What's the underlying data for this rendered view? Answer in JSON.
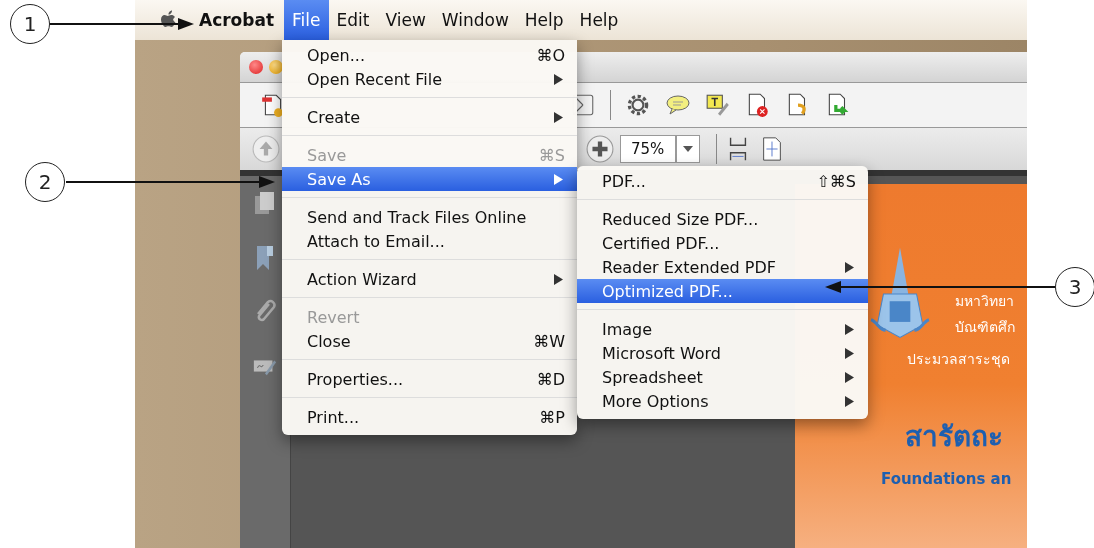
{
  "menu_bar": {
    "app": "Acrobat",
    "items": [
      {
        "label": "File",
        "selected": true
      },
      {
        "label": "Edit",
        "selected": false
      },
      {
        "label": "View",
        "selected": false
      },
      {
        "label": "Window",
        "selected": false
      },
      {
        "label": "Help",
        "selected": false
      },
      {
        "label": "Help",
        "selected": false
      }
    ]
  },
  "file_menu": {
    "groups": [
      {
        "items": [
          {
            "label": "Open...",
            "shortcut": "⌘O",
            "submenu": false,
            "disabled": false,
            "selected": false
          },
          {
            "label": "Open Recent File",
            "submenu": true,
            "disabled": false,
            "selected": false
          }
        ]
      },
      {
        "items": [
          {
            "label": "Create",
            "submenu": true,
            "disabled": false,
            "selected": false
          }
        ]
      },
      {
        "items": [
          {
            "label": "Save",
            "shortcut": "⌘S",
            "submenu": false,
            "disabled": true,
            "selected": false
          },
          {
            "label": "Save As",
            "submenu": true,
            "disabled": false,
            "selected": true
          }
        ]
      },
      {
        "items": [
          {
            "label": "Send and Track Files Online",
            "submenu": false,
            "disabled": false,
            "selected": false
          },
          {
            "label": "Attach to Email...",
            "submenu": false,
            "disabled": false,
            "selected": false
          }
        ]
      },
      {
        "items": [
          {
            "label": "Action Wizard",
            "submenu": true,
            "disabled": false,
            "selected": false
          }
        ]
      },
      {
        "items": [
          {
            "label": "Revert",
            "submenu": false,
            "disabled": true,
            "selected": false
          },
          {
            "label": "Close",
            "shortcut": "⌘W",
            "submenu": false,
            "disabled": false,
            "selected": false
          }
        ]
      },
      {
        "items": [
          {
            "label": "Properties...",
            "shortcut": "⌘D",
            "submenu": false,
            "disabled": false,
            "selected": false
          }
        ]
      },
      {
        "items": [
          {
            "label": "Print...",
            "shortcut": "⌘P",
            "submenu": false,
            "disabled": false,
            "selected": false
          }
        ]
      }
    ]
  },
  "save_as_menu": {
    "groups": [
      {
        "items": [
          {
            "label": "PDF...",
            "shortcut": "⇧⌘S",
            "submenu": false,
            "disabled": false,
            "selected": false
          }
        ]
      },
      {
        "items": [
          {
            "label": "Reduced Size PDF...",
            "submenu": false,
            "disabled": false,
            "selected": false
          },
          {
            "label": "Certified PDF...",
            "submenu": false,
            "disabled": false,
            "selected": false
          },
          {
            "label": "Reader Extended PDF",
            "submenu": true,
            "disabled": false,
            "selected": false
          },
          {
            "label": "Optimized PDF...",
            "submenu": false,
            "disabled": false,
            "selected": true
          }
        ]
      },
      {
        "items": [
          {
            "label": "Image",
            "submenu": true,
            "disabled": false,
            "selected": false
          },
          {
            "label": "Microsoft Word",
            "submenu": true,
            "disabled": false,
            "selected": false
          },
          {
            "label": "Spreadsheet",
            "submenu": true,
            "disabled": false,
            "selected": false
          },
          {
            "label": "More Options",
            "submenu": true,
            "disabled": false,
            "selected": false
          }
        ]
      }
    ]
  },
  "toolbar": {
    "zoom": "75%"
  },
  "document": {
    "lines": [
      "มหาวิทยา",
      "บัณฑิตศึก"
    ],
    "series": "ประมวลสาระชุด",
    "title": "สารัตถะ",
    "subtitle": "Foundations an"
  },
  "callouts": [
    {
      "number": "1"
    },
    {
      "number": "2"
    },
    {
      "number": "3"
    }
  ]
}
